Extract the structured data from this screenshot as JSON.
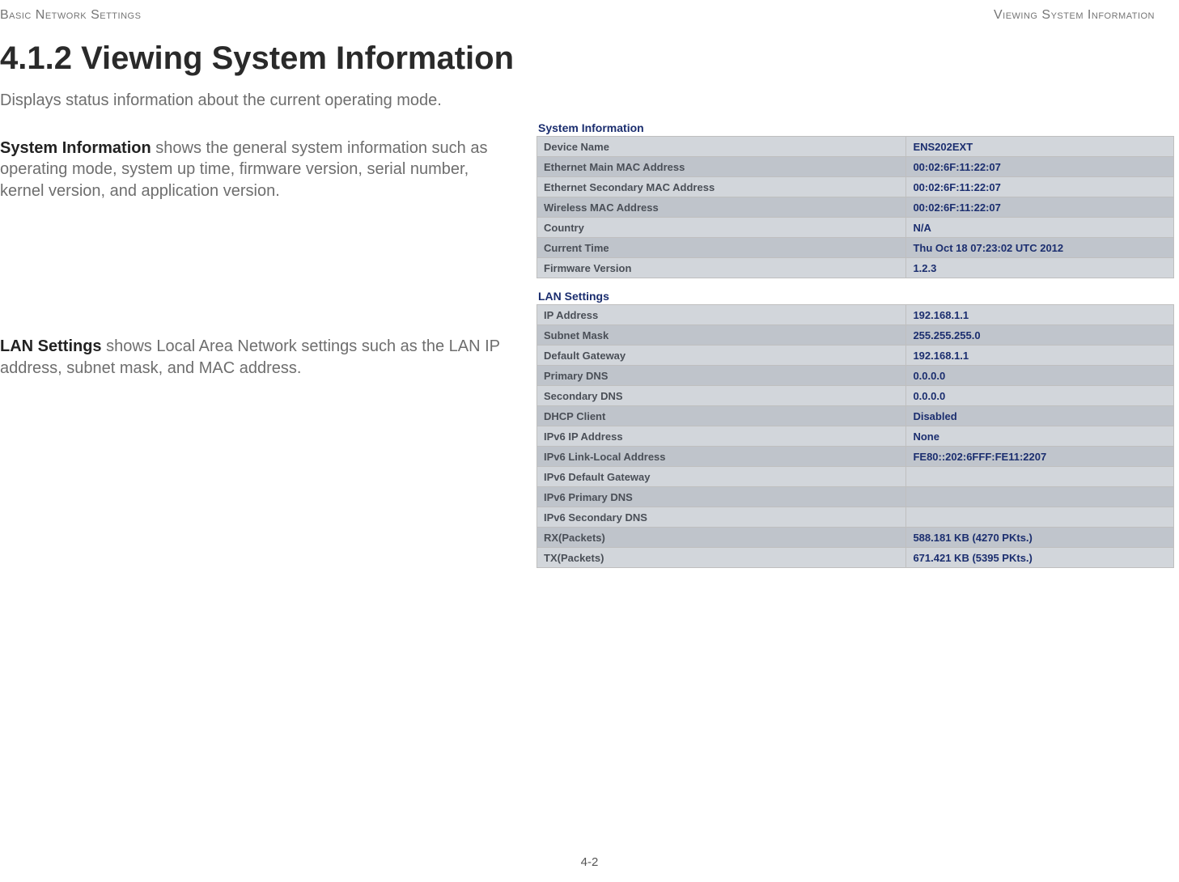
{
  "header_left": "Basic Network Settings",
  "header_right": "Viewing System Information",
  "title": "4.1.2 Viewing System Information",
  "intro": "Displays status information about the current operating mode.",
  "sysinfo_para_strong": "System Information",
  "sysinfo_para_rest": "  shows the general system information such as operating mode, system up time, firmware version, serial number, kernel version, and application version.",
  "lan_para_strong": "LAN Settings",
  "lan_para_rest": "  shows Local Area Network settings such as the LAN IP address, subnet mask, and MAC address.",
  "system_info": {
    "title": "System Information",
    "rows": [
      {
        "label": "Device Name",
        "value": "ENS202EXT"
      },
      {
        "label": "Ethernet Main MAC Address",
        "value": "00:02:6F:11:22:07"
      },
      {
        "label": "Ethernet Secondary MAC Address",
        "value": "00:02:6F:11:22:07"
      },
      {
        "label": "Wireless MAC Address",
        "value": "00:02:6F:11:22:07"
      },
      {
        "label": "Country",
        "value": "N/A"
      },
      {
        "label": "Current Time",
        "value": "Thu Oct 18 07:23:02 UTC 2012"
      },
      {
        "label": "Firmware Version",
        "value": "1.2.3"
      }
    ]
  },
  "lan_settings": {
    "title": "LAN Settings",
    "rows": [
      {
        "label": "IP Address",
        "value": "192.168.1.1"
      },
      {
        "label": "Subnet Mask",
        "value": "255.255.255.0"
      },
      {
        "label": "Default Gateway",
        "value": "192.168.1.1"
      },
      {
        "label": "Primary DNS",
        "value": "0.0.0.0"
      },
      {
        "label": "Secondary DNS",
        "value": "0.0.0.0"
      },
      {
        "label": "DHCP Client",
        "value": "Disabled"
      },
      {
        "label": "IPv6 IP Address",
        "value": "None"
      },
      {
        "label": "IPv6 Link-Local Address",
        "value": "FE80::202:6FFF:FE11:2207"
      },
      {
        "label": "IPv6 Default Gateway",
        "value": ""
      },
      {
        "label": "IPv6 Primary DNS",
        "value": ""
      },
      {
        "label": "IPv6 Secondary DNS",
        "value": ""
      },
      {
        "label": "RX(Packets)",
        "value": "588.181 KB (4270 PKts.)"
      },
      {
        "label": "TX(Packets)",
        "value": "671.421 KB (5395 PKts.)"
      }
    ]
  },
  "page_number": "4-2"
}
